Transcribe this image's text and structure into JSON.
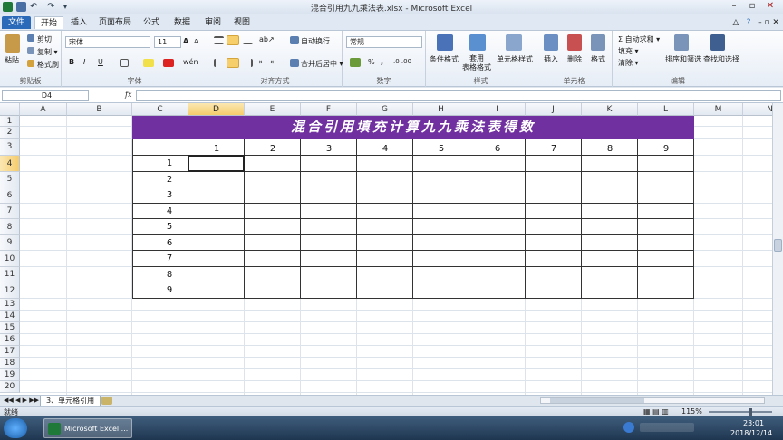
{
  "window": {
    "title": "混合引用九九乘法表.xlsx - Microsoft Excel"
  },
  "tabs": [
    {
      "label": "文件"
    },
    {
      "label": "开始"
    },
    {
      "label": "插入"
    },
    {
      "label": "页面布局"
    },
    {
      "label": "公式"
    },
    {
      "label": "数据"
    },
    {
      "label": "审阅"
    },
    {
      "label": "视图"
    }
  ],
  "ribbon": {
    "clipboard": {
      "paste": "粘贴",
      "cut": "剪切",
      "copy": "复制 ▾",
      "format_painter": "格式刷",
      "label": "剪贴板"
    },
    "font": {
      "name": "宋体",
      "size": "11",
      "grow": "A",
      "shrink": "A",
      "bold": "B",
      "italic": "I",
      "underline": "U",
      "label": "字体"
    },
    "alignment": {
      "wrap": "自动换行",
      "merge": "合并后居中 ▾",
      "label": "对齐方式"
    },
    "number": {
      "format": "常规",
      "percent": "%",
      "comma": ",",
      "label": "数字"
    },
    "styles": {
      "conditional": "条件格式",
      "table": "套用\n表格格式",
      "cell": "单元格样式",
      "label": "样式"
    },
    "cells": {
      "insert": "插入",
      "delete": "删除",
      "format": "格式",
      "label": "单元格"
    },
    "editing": {
      "autosum": "Σ 自动求和 ▾",
      "fill": "填充 ▾",
      "clear": "清除 ▾",
      "sort": "排序和筛选",
      "find": "查找和选择",
      "label": "编辑"
    }
  },
  "formula_bar": {
    "name_box": "D4",
    "fx": "fx",
    "content": ""
  },
  "columns": [
    "A",
    "B",
    "C",
    "D",
    "E",
    "F",
    "G",
    "H",
    "I",
    "J",
    "K",
    "L",
    "M",
    "N"
  ],
  "rows": [
    "1",
    "2",
    "3",
    "4",
    "5",
    "6",
    "7",
    "8",
    "9",
    "10",
    "11",
    "12",
    "13",
    "14",
    "15",
    "16",
    "17",
    "18",
    "19",
    "20"
  ],
  "sheet": {
    "banner": "混合引用填充计算九九乘法表得数",
    "header_numbers": [
      "1",
      "2",
      "3",
      "4",
      "5",
      "6",
      "7",
      "8",
      "9"
    ],
    "row_numbers": [
      "1",
      "2",
      "3",
      "4",
      "5",
      "6",
      "7",
      "8",
      "9"
    ],
    "selected_cell": "D4"
  },
  "sheet_tabs": {
    "active": "3、单元格引用"
  },
  "status": {
    "ready": "就绪",
    "zoom": "115%"
  },
  "taskbar": {
    "app": "Microsoft Excel ...",
    "time": "23:01",
    "date": "2018/12/14"
  },
  "colors": {
    "banner": "#7030a0",
    "accent": "#2a6ab8",
    "selection_header": "#f5cc6b"
  }
}
